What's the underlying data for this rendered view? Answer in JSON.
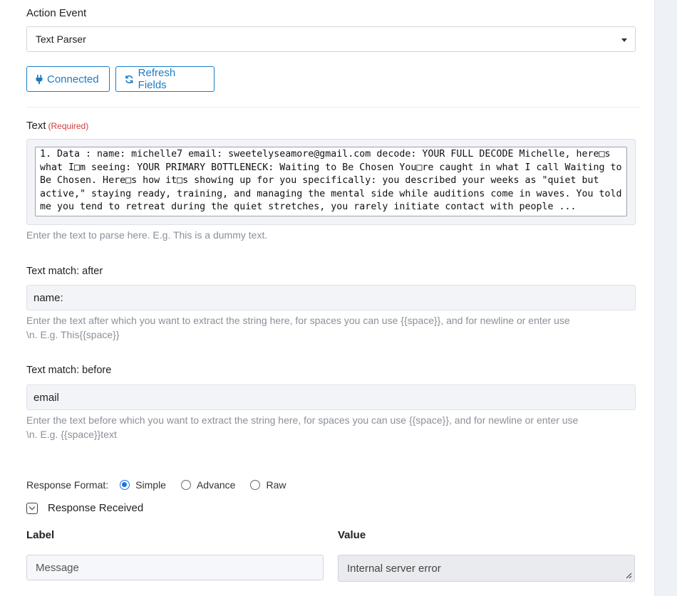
{
  "action_event": {
    "label": "Action Event",
    "selected": "Text Parser"
  },
  "buttons": {
    "connected": "Connected",
    "refresh": "Refresh Fields"
  },
  "text_field": {
    "label": "Text",
    "required": "(Required)",
    "value": "1. Data : name: michelle7 email: sweetelyseamore@gmail.com decode: YOUR FULL DECODE Michelle, here□s what I□m seeing: YOUR PRIMARY BOTTLENECK: Waiting to Be Chosen You□re caught in what I call Waiting to Be Chosen. Here□s how it□s showing up for you specifically: you described your weeks as \"quiet but active,\" staying ready, training, and managing the mental side while auditions come in waves. You told me you tend to retreat during the quiet stretches, you rarely initiate contact with people ...",
    "help": "Enter the text to parse here. E.g. This is a dummy text."
  },
  "match_after": {
    "label": "Text match: after",
    "value": "name:",
    "help_line1": "Enter the text after which you want to extract the string here, for spaces you can use {{space}}, and for newline or enter use",
    "help_line2": "\\n. E.g. This{{space}}"
  },
  "match_before": {
    "label": "Text match: before",
    "value": "email",
    "help_line1": "Enter the text before which you want to extract the string here, for spaces you can use {{space}}, and for newline or enter use",
    "help_line2": "\\n. E.g. {{space}}text"
  },
  "response_format": {
    "label": "Response Format:",
    "options": [
      "Simple",
      "Advance",
      "Raw"
    ],
    "selected": "Simple"
  },
  "response_received": {
    "label": "Response Received",
    "col_label": "Label",
    "col_value": "Value",
    "row_label": "Message",
    "row_value": "Internal server error"
  },
  "colors": {
    "accent": "#1a7cc6",
    "required": "#d23c3c",
    "radio": "#1a73e8"
  }
}
